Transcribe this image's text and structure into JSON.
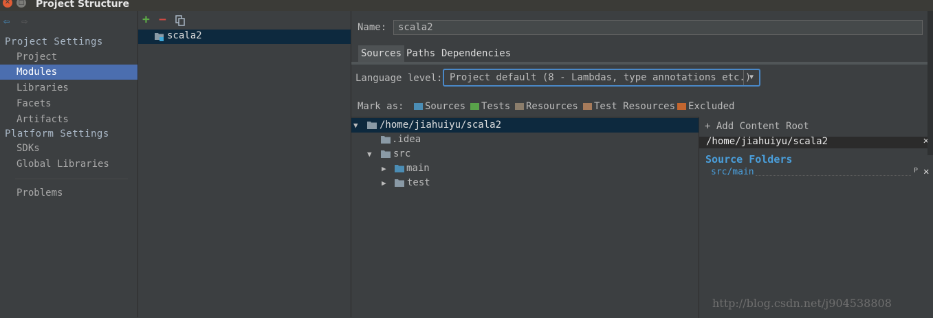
{
  "window": {
    "title": "Project Structure",
    "close_glyph": "✕",
    "maximize_glyph": "□"
  },
  "sidebar": {
    "back_glyph": "⇦",
    "forward_glyph": "⇨",
    "project_settings_header": "Project Settings",
    "project_items": [
      {
        "label": "Project"
      },
      {
        "label": "Modules",
        "selected": true
      },
      {
        "label": "Libraries"
      },
      {
        "label": "Facets"
      },
      {
        "label": "Artifacts"
      }
    ],
    "platform_settings_header": "Platform Settings",
    "platform_items": [
      {
        "label": "SDKs"
      },
      {
        "label": "Global Libraries"
      }
    ],
    "problems_label": "Problems"
  },
  "modules": {
    "add_glyph": "+",
    "remove_glyph": "−",
    "items": [
      {
        "name": "scala2"
      }
    ]
  },
  "module_editor": {
    "name_label": "Name:",
    "name_value": "scala2",
    "tabs": [
      {
        "label": "Sources",
        "active": true
      },
      {
        "label": "Paths"
      },
      {
        "label": "Dependencies"
      }
    ],
    "language_level_label": "Language level:",
    "language_level_value": "Project default (8 - Lambdas, type annotations etc.)",
    "dropdown_glyph": "▼",
    "mark_as_label": "Mark as:",
    "mark_as": [
      {
        "label": "Sources",
        "color": "#4b8db5"
      },
      {
        "label": "Tests",
        "color": "#59a34a"
      },
      {
        "label": "Resources",
        "color": "#8b7d6b"
      },
      {
        "label": "Test Resources",
        "color": "#a67b5b"
      },
      {
        "label": "Excluded",
        "color": "#c4662f"
      }
    ]
  },
  "tree": {
    "expanded_glyph": "▼",
    "collapsed_glyph": "▶",
    "nodes": [
      {
        "label": "/home/jiahuiyu/scala2",
        "expanded": true,
        "selected": true
      },
      {
        "label": ".idea"
      },
      {
        "label": "src",
        "expanded": true
      },
      {
        "label": "main",
        "source_folder": true
      },
      {
        "label": "test"
      }
    ]
  },
  "content_root": {
    "add_label": "Add Content Root",
    "add_glyph": "+",
    "path": "/home/jiahuiyu/scala2",
    "close_glyph": "✕",
    "source_folders_header": "Source Folders",
    "source_folders": [
      "src/main"
    ],
    "edit_glyph": "P"
  },
  "watermark": "http://blog.csdn.net/j904538808",
  "colors": {
    "background": "#3c3f41",
    "selection": "#4b6eaf",
    "tree_selection": "#0d293e",
    "accent_blue": "#4a9fdc",
    "focus_border": "#4a88c7"
  }
}
